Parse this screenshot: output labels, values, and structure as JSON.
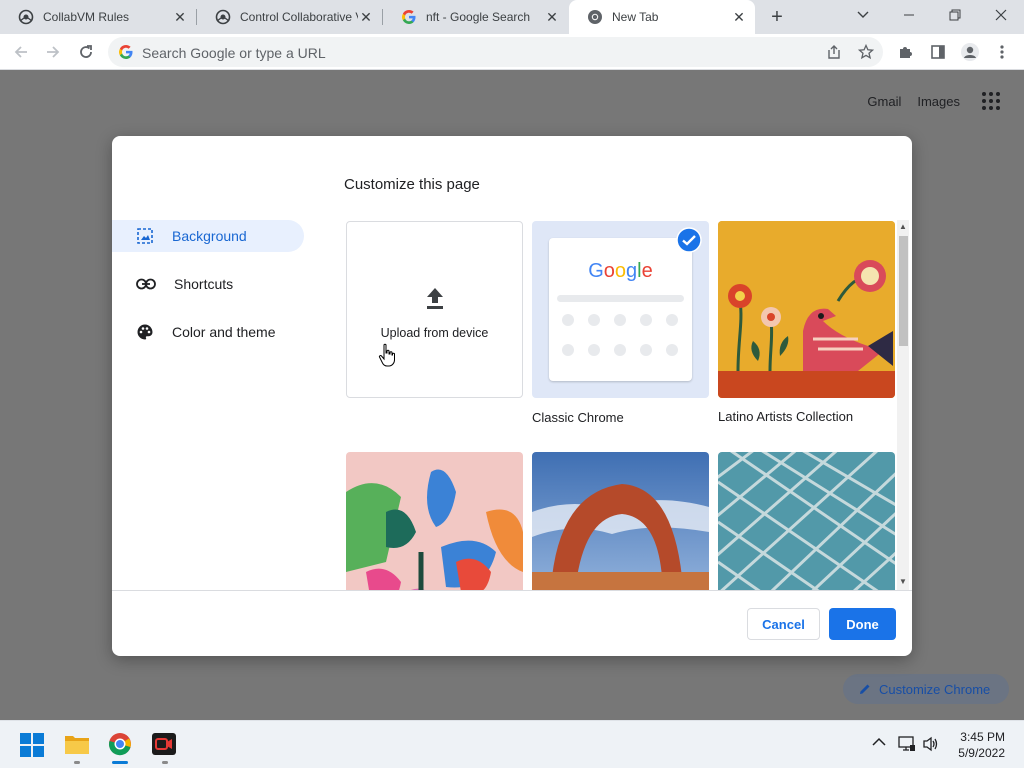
{
  "tabs": [
    {
      "title": "CollabVM Rules",
      "icon": "collabvm-icon"
    },
    {
      "title": "Control Collaborative V",
      "icon": "collabvm-icon"
    },
    {
      "title": "nft - Google Search",
      "icon": "google-icon"
    },
    {
      "title": "New Tab",
      "icon": "chrome-icon",
      "active": true
    }
  ],
  "omnibox": {
    "placeholder": "Search Google or type a URL"
  },
  "page": {
    "gmail_link": "Gmail",
    "images_link": "Images",
    "customize_chrome": "Customize Chrome"
  },
  "dialog": {
    "title": "Customize this page",
    "menu": [
      {
        "label": "Background",
        "icon": "background-icon",
        "selected": true
      },
      {
        "label": "Shortcuts",
        "icon": "link-icon"
      },
      {
        "label": "Color and theme",
        "icon": "palette-icon"
      }
    ],
    "tiles": {
      "upload": "Upload from device",
      "classic_chrome": "Classic Chrome",
      "classic_chrome_logo": "Google",
      "latino_artists": "Latino Artists Collection"
    },
    "cancel": "Cancel",
    "done": "Done"
  },
  "taskbar": {
    "time": "3:45 PM",
    "date": "5/9/2022"
  },
  "colors": {
    "accent": "#1a73e8",
    "selected_bg": "#e8f0fe",
    "overlay": "#777777"
  }
}
